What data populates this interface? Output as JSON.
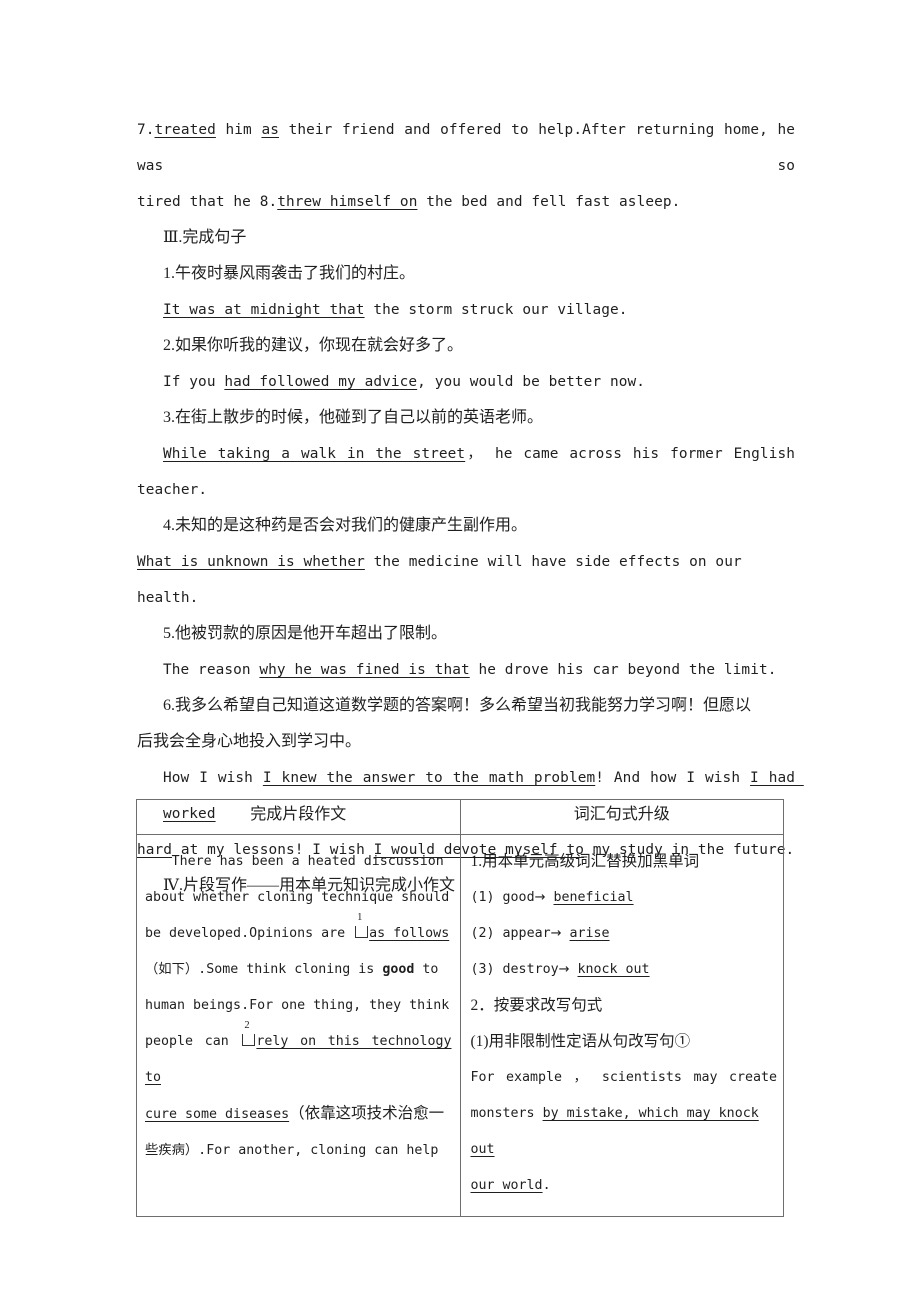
{
  "document": {
    "top_exercise": {
      "item7_num": "7.",
      "item7_blank": "treated",
      "item7_rest_a": " him ",
      "item7_underline_as": "as",
      "item7_rest_b": " their friend and offered to help.After returning home, he was so",
      "item7_line2_a": "tired that he 8.",
      "item7_blank2": "threw himself on",
      "item7_line2_b": " the bed and fell fast asleep."
    },
    "section3": {
      "heading": "Ⅲ.完成句子",
      "items": [
        {
          "num": "1.",
          "chinese": "午夜时暴风雨袭击了我们的村庄。",
          "answer_blank": "It was at midnight that",
          "answer_rest": " the storm struck our village."
        },
        {
          "num": "2.",
          "chinese": "如果你听我的建议，你现在就会好多了。",
          "answer_pre": "If you ",
          "answer_blank": "had followed my advice",
          "answer_rest": ", you would be better now."
        },
        {
          "num": "3.",
          "chinese": "在街上散步的时候，他碰到了自己以前的英语老师。",
          "answer_blank": "While taking a walk in the street",
          "answer_rest": "， he came across his former English",
          "answer_wrap": "teacher."
        },
        {
          "num": "4.",
          "chinese": "未知的是这种药是否会对我们的健康产生副作用。",
          "answer_blank": "What is unknown is whether",
          "answer_rest": " the medicine will have side effects on our health."
        },
        {
          "num": "5.",
          "chinese": "他被罚款的原因是他开车超出了限制。",
          "answer_pre": "The reason ",
          "answer_blank": "why he was fined is that",
          "answer_rest": " he drove his car beyond the limit."
        },
        {
          "num": "6.",
          "chinese": "我多么希望自己知道这道数学题的答案啊！多么希望当初我能努力学习啊！但愿以",
          "chinese_wrap": "后我会全身心地投入到学习中。",
          "answer_pre": "How I wish ",
          "answer_blank1": "I knew the answer to the math problem",
          "answer_mid": "! And how I wish ",
          "answer_blank2": "I had worked",
          "answer_blank2_wrap": "hard",
          "answer_rest": " at my lessons! I wish ",
          "answer_blank3": "I would devote myself to",
          "answer_tail": " my study in the future."
        }
      ]
    },
    "section4": {
      "heading": "Ⅳ.片段写作——用本单元知识完成小作文",
      "table": {
        "headers": [
          "完成片段作文",
          "词汇句式升级"
        ],
        "left_cell": {
          "line1": "There has been a heated discussion",
          "line2": "about whether cloning technique should",
          "line3_pre": "be developed.Opinions are ",
          "line3_mark": "1",
          "line3_blank": "as follows",
          "line4_pre": "（如下）.Some think cloning is ",
          "line4_bold": "good",
          "line4_post": " to",
          "line5": "human beings.For one thing, they think",
          "line6_pre": "people can ",
          "line6_mark": "2",
          "line6_blank": "rely on this technology to",
          "line7_blank": "cure some diseases",
          "line7_post": "（依靠这项技术治愈一",
          "line8": "些疾病）.For another, cloning can help"
        },
        "right_cell": {
          "item1_title": "1.用本单元高级词汇替换加黑单词",
          "subs": [
            {
              "num": "(1)",
              "from": "good",
              "arrow": "→",
              "to": "beneficial"
            },
            {
              "num": "(2)",
              "from": "appear",
              "arrow": "→",
              "to": "arise"
            },
            {
              "num": "(3)",
              "from": "destroy",
              "arrow": "→",
              "to": "knock out"
            }
          ],
          "item2_title": "2．按要求改写句式",
          "item2_sub1": "(1)用非限制性定语从句改写句①",
          "answer_pre": "For example ， scientists may create",
          "answer_line2_pre": "monsters ",
          "answer_line2_blank": "by mistake, which may knock out",
          "answer_line3_blank": "our world",
          "answer_line3_post": "."
        }
      }
    }
  }
}
